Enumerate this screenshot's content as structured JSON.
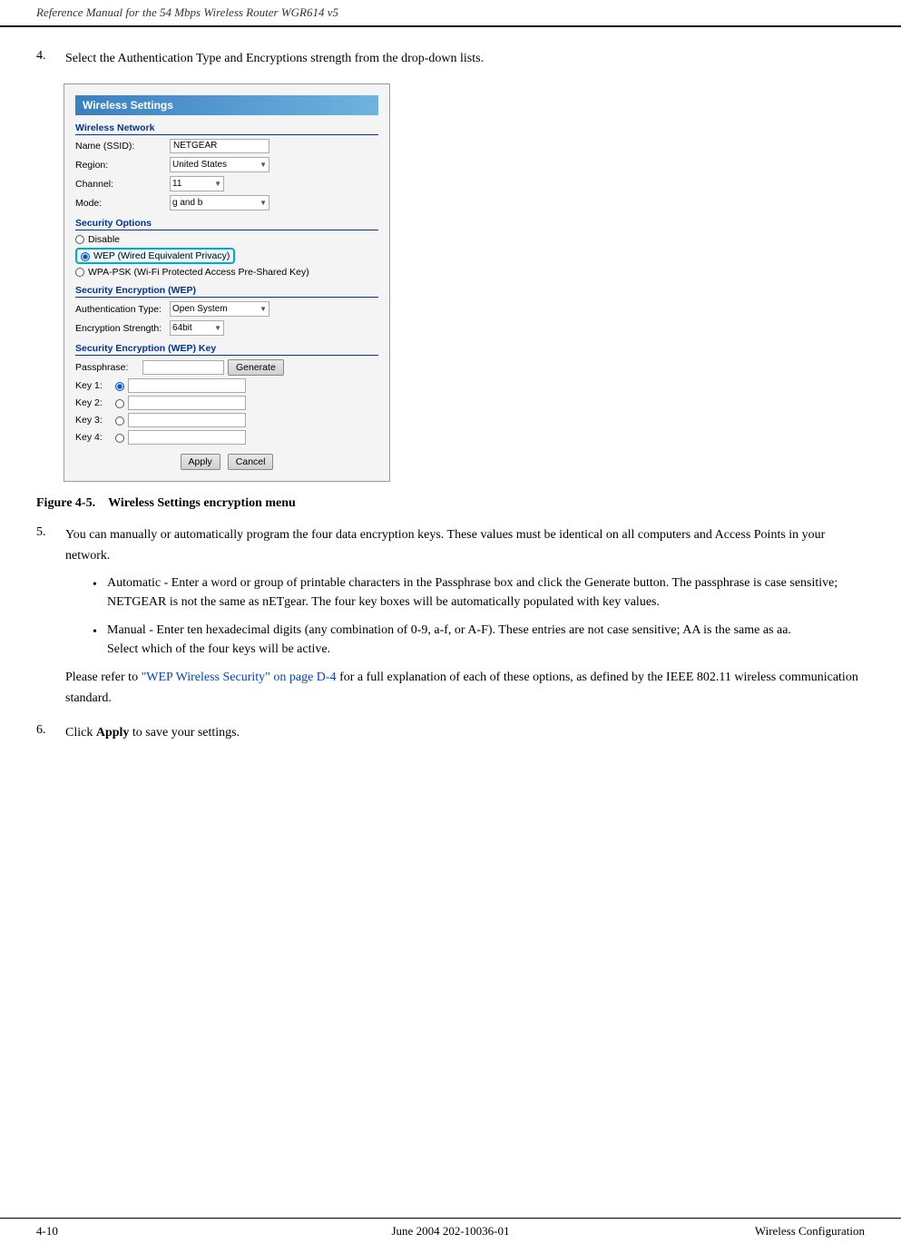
{
  "header": {
    "text": "Reference Manual for the 54 Mbps Wireless Router WGR614 v5"
  },
  "footer": {
    "left": "4-10",
    "center": "June 2004 202-10036-01",
    "right": "Wireless Configuration"
  },
  "step4": {
    "num": "4.",
    "text": "Select the Authentication Type and Encryptions strength from the drop-down lists."
  },
  "screenshot": {
    "title": "Wireless Settings",
    "sections": {
      "wireless_network": {
        "label": "Wireless Network",
        "fields": [
          {
            "label": "Name (SSID):",
            "value": "NETGEAR",
            "type": "input"
          },
          {
            "label": "Region:",
            "value": "United States",
            "type": "select"
          },
          {
            "label": "Channel:",
            "value": "11",
            "type": "select-small"
          },
          {
            "label": "Mode:",
            "value": "g and b",
            "type": "select"
          }
        ]
      },
      "security_options": {
        "label": "Security Options",
        "options": [
          {
            "label": "Disable",
            "selected": false
          },
          {
            "label": "WEP (Wired Equivalent Privacy)",
            "selected": true,
            "highlighted": true
          },
          {
            "label": "WPA-PSK (Wi-Fi Protected Access Pre-Shared Key)",
            "selected": false
          }
        ]
      },
      "security_encryption": {
        "label": "Security Encryption (WEP)",
        "fields": [
          {
            "label": "Authentication Type:",
            "value": "Open System",
            "type": "select"
          },
          {
            "label": "Encryption Strength:",
            "value": "64bit",
            "type": "select"
          }
        ]
      },
      "wep_key": {
        "label": "Security Encryption (WEP) Key",
        "passphrase_label": "Passphrase:",
        "generate_btn": "Generate",
        "keys": [
          {
            "label": "Key 1:",
            "selected": true
          },
          {
            "label": "Key 2:",
            "selected": false
          },
          {
            "label": "Key 3:",
            "selected": false
          },
          {
            "label": "Key 4:",
            "selected": false
          }
        ]
      }
    },
    "buttons": {
      "apply": "Apply",
      "cancel": "Cancel"
    }
  },
  "figure": {
    "label": "Figure 4-5.",
    "title": "Wireless Settings encryption menu"
  },
  "step5": {
    "num": "5.",
    "text": "You can manually or automatically program the four data encryption keys. These values must be identical on all computers and Access Points in your network.",
    "bullets": [
      {
        "bullet": "•",
        "text": "Automatic - Enter a word or group of printable characters in the Passphrase box and click the Generate button. The passphrase is case sensitive; NETGEAR is not the same as nETgear. The four key boxes will be automatically populated with key values."
      },
      {
        "bullet": "•",
        "text": "Manual - Enter ten hexadecimal digits (any combination of 0-9, a-f, or A-F). These entries are not case sensitive; AA is the same as aa.\nSelect which of the four keys will be active."
      }
    ],
    "link_prefix": "Please refer to ",
    "link_text": "\"WEP Wireless Security\" on page D-4",
    "link_suffix": " for a full explanation of each of these options, as defined by the IEEE 802.11 wireless communication standard."
  },
  "step6": {
    "num": "6.",
    "text": "Click ",
    "bold": "Apply",
    "text2": " to save your settings."
  }
}
